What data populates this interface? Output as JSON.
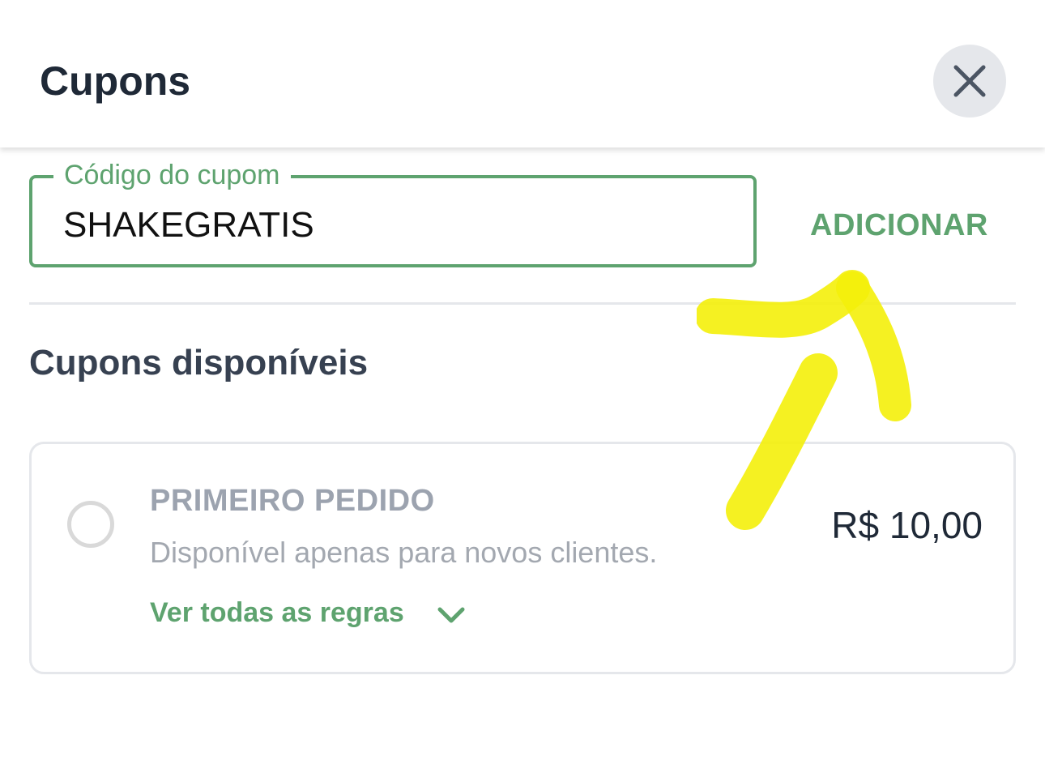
{
  "header": {
    "title": "Cupons",
    "close_icon": "close-icon"
  },
  "coupon_input": {
    "label": "Código do cupom",
    "value": "SHAKEGRATIS",
    "add_label": "ADICIONAR"
  },
  "available": {
    "title": "Cupons disponíveis",
    "coupons": [
      {
        "name": "PRIMEIRO PEDIDO",
        "description": "Disponível apenas para novos clientes.",
        "value": "R$ 10,00",
        "rules_label": "Ver todas as regras",
        "selected": false
      }
    ]
  },
  "colors": {
    "accent_green": "#5ea36f",
    "title_dark": "#1f2937",
    "muted_gray": "#9ca3af",
    "highlighter_yellow": "#f4ef0a"
  },
  "annotation": {
    "type": "hand-drawn highlighter arrow",
    "icon": "arrow-up-right-icon"
  }
}
